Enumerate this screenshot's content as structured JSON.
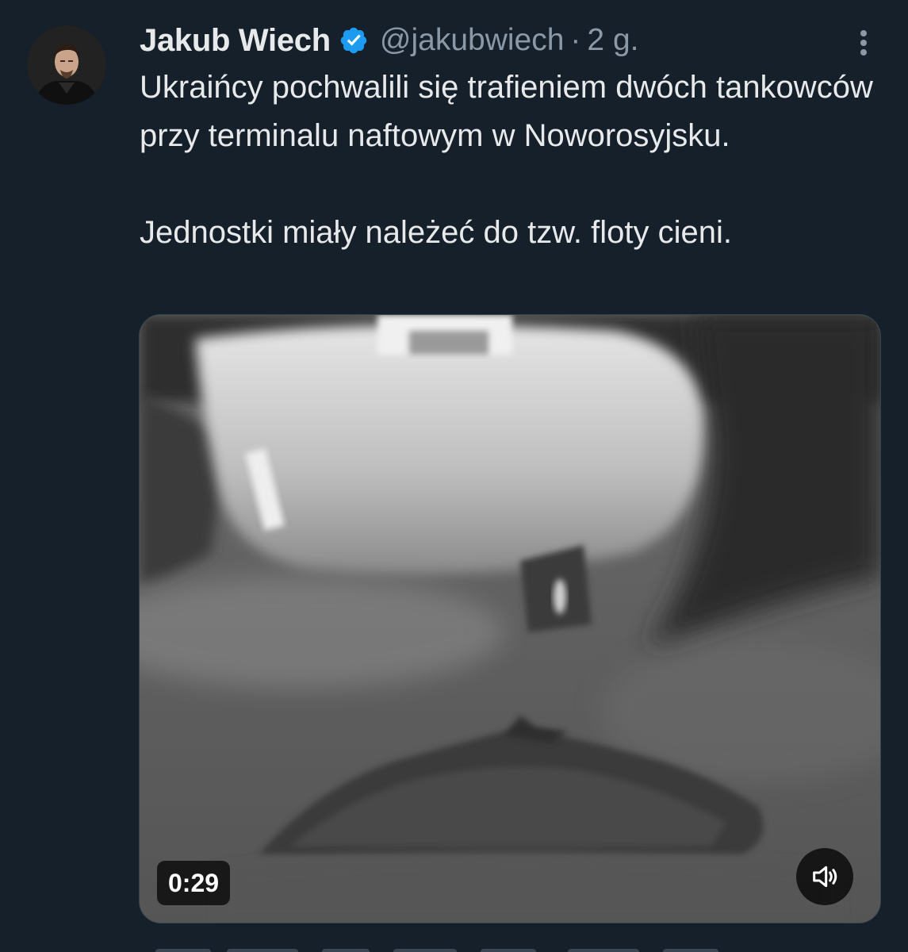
{
  "tweet": {
    "author": {
      "display_name": "Jakub Wiech",
      "handle": "@jakubwiech",
      "verified": true,
      "avatar_icon": "profile-photo"
    },
    "separator": "·",
    "time": "2 g.",
    "more_icon": "more-vertical-icon",
    "text_lines": [
      "Ukraińcy pochwalili się trafieniem dwóch tankowców przy terminalu naftowym w Noworosyjsku.",
      "Jednostki miały należeć do tzw. floty cieni."
    ],
    "media": {
      "type": "video",
      "duration": "0:29",
      "mute_icon": "speaker-muted-icon"
    }
  },
  "colors": {
    "background": "#15202b",
    "text": "#e7e9ea",
    "secondary": "#8b98a5",
    "verified_badge": "#1d9bf0"
  }
}
